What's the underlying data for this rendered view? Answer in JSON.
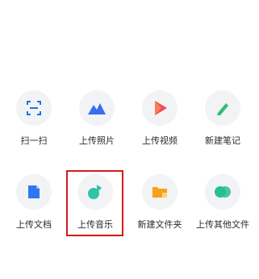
{
  "actions": [
    {
      "id": "scan",
      "label": "扫一扫",
      "icon": "scan-icon",
      "color": "#1a73e8"
    },
    {
      "id": "upload-photo",
      "label": "上传照片",
      "icon": "mountain-photo-icon",
      "color": "#3a6cf4"
    },
    {
      "id": "upload-video",
      "label": "上传视频",
      "icon": "play-video-icon",
      "color": "#f24a5c"
    },
    {
      "id": "new-note",
      "label": "新建笔记",
      "icon": "pen-note-icon",
      "color": "#2fbf71"
    },
    {
      "id": "upload-doc",
      "label": "上传文档",
      "icon": "document-icon",
      "color": "#2e77f2"
    },
    {
      "id": "upload-music",
      "label": "上传音乐",
      "icon": "music-note-icon",
      "color": "#2ec4a5"
    },
    {
      "id": "new-folder",
      "label": "新建文件夹",
      "icon": "folder-icon",
      "color": "#f6a21a"
    },
    {
      "id": "upload-other",
      "label": "上传其他文件",
      "icon": "other-file-icon",
      "color": "#27c08f"
    }
  ],
  "highlighted": "upload-music",
  "highlight_color": "#d31b1b"
}
